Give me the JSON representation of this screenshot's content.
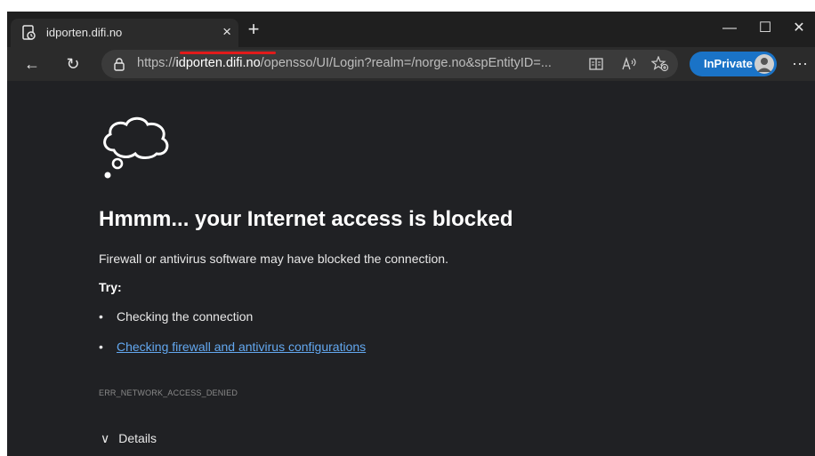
{
  "tab": {
    "title": "idporten.difi.no",
    "close": "×",
    "favicon": "page-icon"
  },
  "newtab": "+",
  "window_controls": {
    "minimize": "—",
    "maximize": "☐",
    "close": "✕"
  },
  "toolbar": {
    "back": "←",
    "refresh": "↻"
  },
  "address": {
    "scheme": "https://",
    "host": "idporten.difi.no",
    "path": "/opensso/UI/Login?realm=/norge.no&spEntityID=..."
  },
  "inprivate": {
    "label": "InPrivate"
  },
  "more": "···",
  "page": {
    "heading": "Hmmm... your Internet access is blocked",
    "message": "Firewall or antivirus software may have blocked the connection.",
    "try_label": "Try:",
    "bullets": [
      "Checking the connection",
      "Checking firewall and antivirus configurations"
    ],
    "bullet_char": "•",
    "error_code": "ERR_NETWORK_ACCESS_DENIED",
    "details": "Details",
    "details_chevron": "∨"
  },
  "colors": {
    "accent": "#1a73c7",
    "link": "#63a8f0",
    "annotation": "#e11b1b",
    "background": "#202124"
  }
}
